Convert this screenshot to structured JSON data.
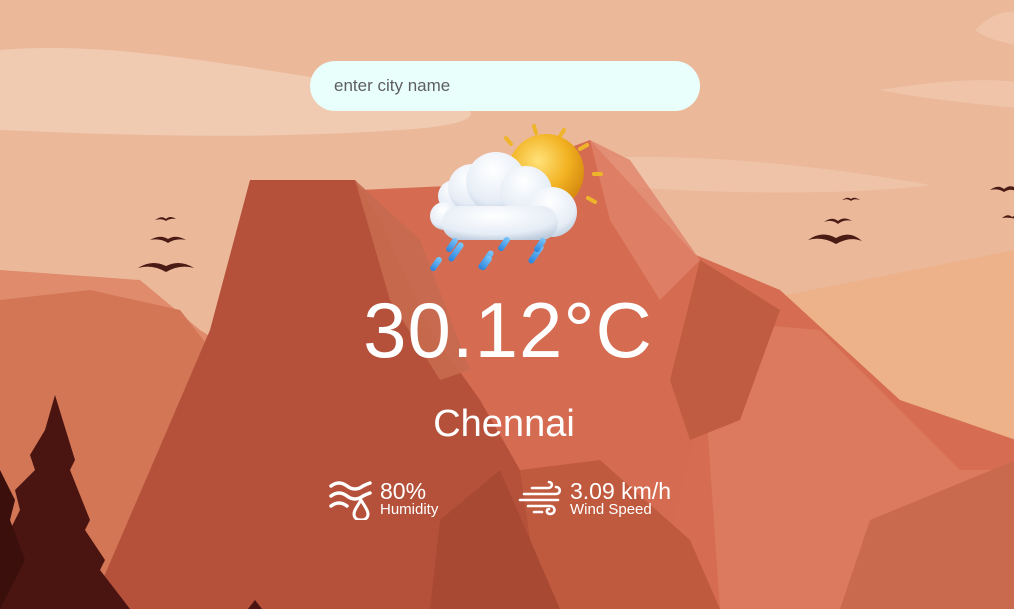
{
  "search": {
    "placeholder": "enter city name",
    "value": ""
  },
  "weather": {
    "icon": "sun-behind-rain-cloud-icon",
    "temperature": "30.12°C",
    "city": "Chennai",
    "humidity": {
      "value": "80%",
      "label": "Humidity",
      "icon": "humidity-icon"
    },
    "wind": {
      "value": "3.09 km/h",
      "label": "Wind Speed",
      "icon": "wind-icon"
    }
  },
  "colors": {
    "sky": "#ebb89a",
    "mountain_dark": "#b55236",
    "mountain_mid": "#d06a4f",
    "tree": "#4a1410",
    "search_bg": "#e9fffc",
    "text": "#ffffff"
  }
}
